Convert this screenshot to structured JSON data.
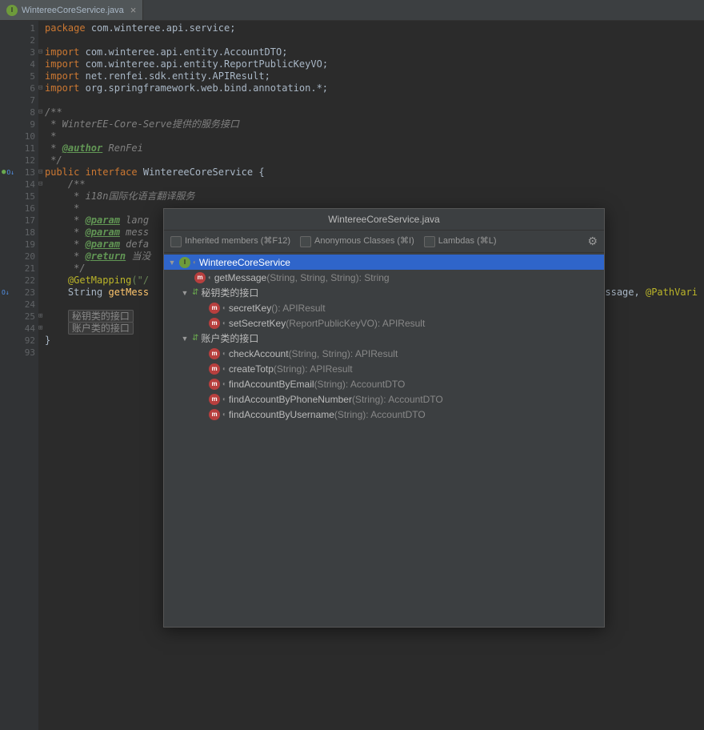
{
  "tab": {
    "filename": "WintereeCoreService.java",
    "icon": "I"
  },
  "gutter": {
    "lines": [
      "1",
      "2",
      "3",
      "4",
      "5",
      "6",
      "7",
      "8",
      "9",
      "10",
      "11",
      "12",
      "13",
      "14",
      "15",
      "16",
      "17",
      "18",
      "19",
      "20",
      "21",
      "22",
      "23",
      "24",
      "25",
      "44",
      "92",
      "93"
    ]
  },
  "code": {
    "package": "package",
    "packageName": "com.winteree.api.service",
    "import": "import",
    "imp1": "com.winteree.api.entity.AccountDTO",
    "imp2": "com.winteree.api.entity.ReportPublicKeyVO",
    "imp3": "net.renfei.sdk.entity.APIResult",
    "imp4": "org.springframework.web.bind.annotation.",
    "docStart": "/**",
    "doc1": " * WinterEE-Core-Serve提供的服务接口",
    "doc2": " *",
    "doc3": " * ",
    "authorTag": "@author",
    "authorName": " RenFei",
    "docEnd": " */",
    "public": "public",
    "interface": "interface",
    "className": "WintereeCoreService",
    "brace": " {",
    "innerDocStart": "    /**",
    "innerDoc1": "     * i18n国际化语言翻译服务",
    "innerDoc2": "     *",
    "paramTag": "@param",
    "param1": " lang",
    "param2": " mess",
    "param3": " defa",
    "returnTag": "@return",
    "returnTxt": " 当没",
    "innerDocEnd": "     */",
    "getMapping": "@GetMapping",
    "getMappingArg": "(\"/",
    "stringType": "String ",
    "getMessage": "getMess",
    "closeBrace": "}",
    "fold1": "秘钥类的接口",
    "fold2": "账户类的接口",
    "tailMessage": "message",
    "tailPathVar": "@PathVari"
  },
  "popup": {
    "title": "WintereeCoreService.java",
    "inherited": "Inherited members (⌘F12)",
    "anonymous": "Anonymous Classes (⌘I)",
    "lambdas": "Lambdas (⌘L)",
    "tree": {
      "root": "WintereeCoreService",
      "rootIcon": "I",
      "m1": "getMessage",
      "m1sig": "(String, String, String): String",
      "group1": "秘钥类的接口",
      "m2": "secretKey",
      "m2sig": "(): APIResult",
      "m3": "setSecretKey",
      "m3sig": "(ReportPublicKeyVO): APIResult",
      "group2": "账户类的接口",
      "m4": "checkAccount",
      "m4sig": "(String, String): APIResult",
      "m5": "createTotp",
      "m5sig": "(String): APIResult",
      "m6": "findAccountByEmail",
      "m6sig": "(String): AccountDTO",
      "m7": "findAccountByPhoneNumber",
      "m7sig": "(String): AccountDTO",
      "m8": "findAccountByUsername",
      "m8sig": "(String): AccountDTO"
    }
  }
}
